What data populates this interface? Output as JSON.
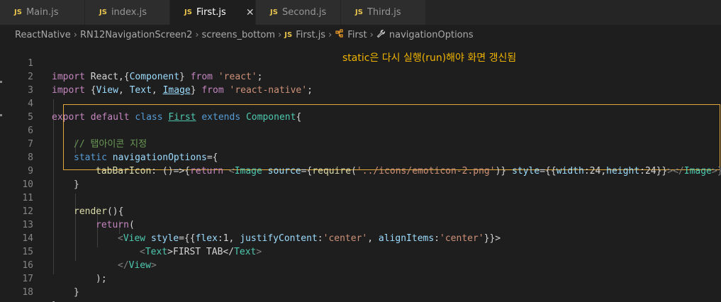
{
  "tabs": [
    {
      "label": "Main.js",
      "active": false
    },
    {
      "label": "index.js",
      "active": false
    },
    {
      "label": "First.js",
      "active": true
    },
    {
      "label": "Second.js",
      "active": false
    },
    {
      "label": "Third.js",
      "active": false
    }
  ],
  "tab_icon_text": "JS",
  "close_glyph": "✕",
  "breadcrumb": {
    "items": [
      "ReactNative",
      "RN12NavigationScreen2",
      "screens_bottom",
      "First.js",
      "First",
      "navigationOptions"
    ],
    "separator": "›"
  },
  "annotation": "static은 다시 실행(run)해야 화면 갱신됨",
  "line_numbers": [
    "1",
    "2",
    "3",
    "4",
    "5",
    "6",
    "7",
    "8",
    "9",
    "10",
    "11",
    "12",
    "13",
    "14",
    "15",
    "16",
    "17",
    "18"
  ],
  "code": {
    "l1": {
      "a": "import",
      "b": " React,{",
      "c": "Component",
      "d": "} ",
      "e": "from",
      "f": " ",
      "g": "'react'",
      "h": ";"
    },
    "l2": {
      "a": "import",
      "b": " {",
      "c": "View",
      "d": ", ",
      "e": "Text",
      "f": ", ",
      "g": "Image",
      "h": "} ",
      "i": "from",
      "j": " ",
      "k": "'react-native'",
      "l": ";"
    },
    "l4": {
      "a": "export",
      "b": " ",
      "c": "default",
      "d": " ",
      "e": "class",
      "f": " ",
      "g": "First",
      "h": " ",
      "i": "extends",
      "j": " ",
      "k": "Component",
      "l": "{"
    },
    "l6": {
      "a": "// 탭아이콘 지정"
    },
    "l7": {
      "a": "static",
      "b": " ",
      "c": "navigationOptions",
      "d": "={"
    },
    "l8": {
      "a": "tabBarIcon",
      "b": ": ()=>{",
      "c": "return",
      "d": " <",
      "e": "Image",
      "f": " ",
      "g": "source",
      "h": "={",
      "i": "require",
      "j": "(",
      "k": "'../icons/emoticon-2.png'",
      "l": ")} ",
      "m": "style",
      "n": "={{",
      "o": "width",
      "p": ":24,",
      "q": "height",
      "r": ":24",
      "s": "}}",
      "t": "></",
      "u": "Image",
      "v": ">}"
    },
    "l9": {
      "a": "}"
    },
    "l11": {
      "a": "render",
      "b": "(){"
    },
    "l12": {
      "a": "return",
      "b": "("
    },
    "l13": {
      "a": "<",
      "b": "View",
      "c": " ",
      "d": "style",
      "e": "={{",
      "f": "flex",
      "g": ":1, ",
      "h": "justifyContent",
      "i": ":",
      "j": "'center'",
      "k": ", ",
      "l": "alignItems",
      "m": ":",
      "n": "'center'",
      "o": "}}>"
    },
    "l14": {
      "a": "<",
      "b": "Text",
      "c": ">FIRST TAB</",
      "d": "Text",
      "e": ">"
    },
    "l15": {
      "a": "</",
      "b": "View",
      "c": ">"
    },
    "l16": {
      "a": ");"
    },
    "l17": {
      "a": "}"
    },
    "l18": {
      "a": "}"
    }
  },
  "colors": {
    "annotation": "#f0b400",
    "highlight_box": "#e2a93a",
    "js_badge": "#e8c44d"
  }
}
